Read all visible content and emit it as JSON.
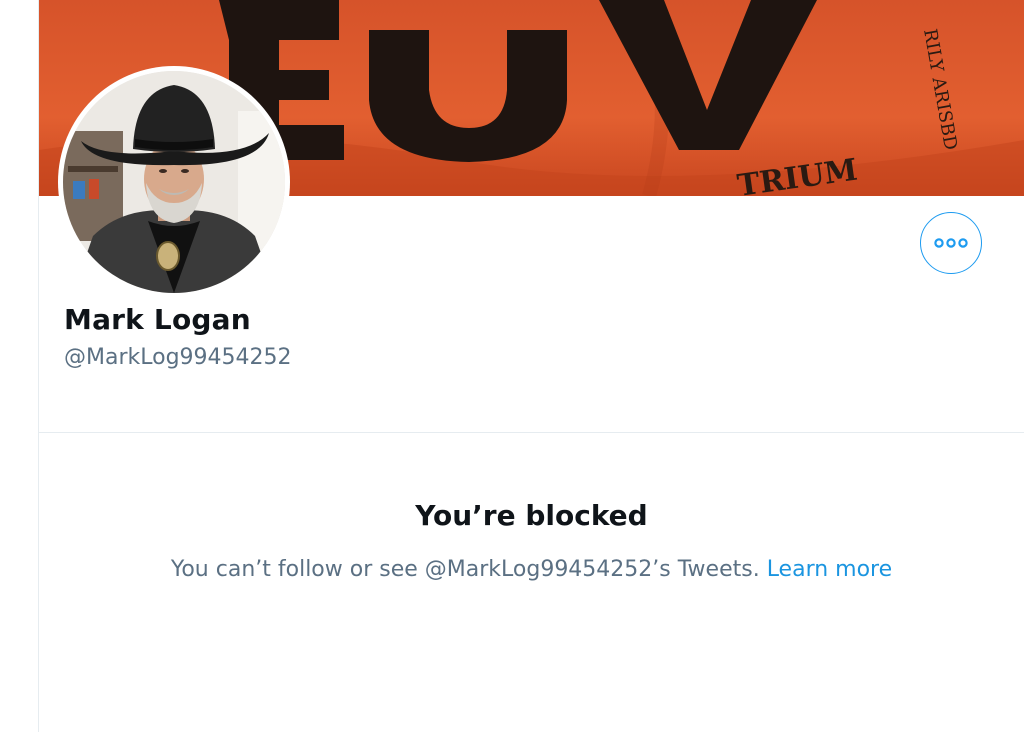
{
  "profile": {
    "display_name": "Mark Logan",
    "handle": "@MarkLog99454252"
  },
  "more_button": {
    "icon": "more-horizontal-icon"
  },
  "blocked": {
    "title": "You’re blocked",
    "message": "You can’t follow or see @MarkLog99454252’s Tweets.",
    "learn_more": "Learn more"
  },
  "colors": {
    "accent": "#1d9bf0",
    "secondary_text": "#5b7083",
    "banner": "#e05a2b"
  }
}
